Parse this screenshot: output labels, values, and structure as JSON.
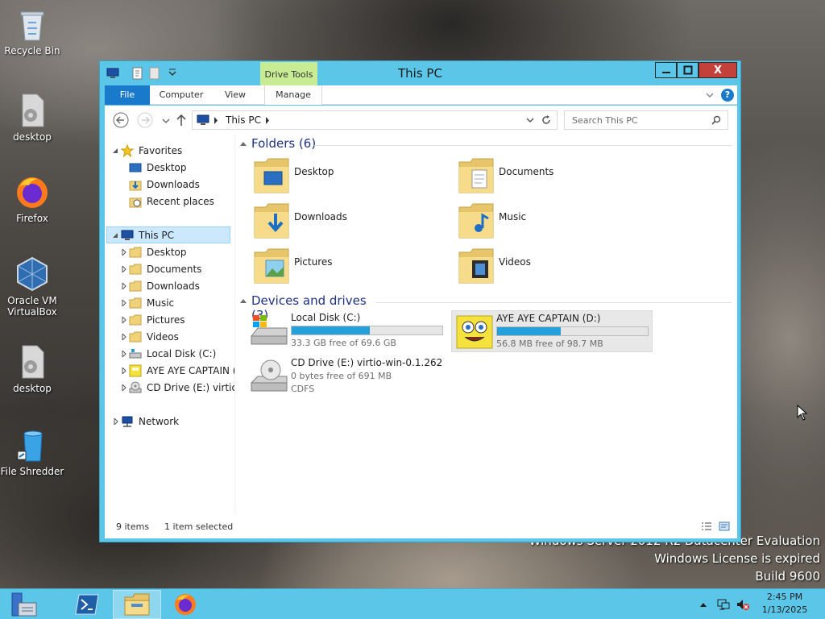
{
  "desktop": {
    "icons": [
      {
        "label": "Recycle Bin",
        "icon": "recycle-bin-icon"
      },
      {
        "label": "desktop",
        "icon": "gear-file-icon"
      },
      {
        "label": "Firefox",
        "icon": "firefox-icon"
      },
      {
        "label": "Oracle VM VirtualBox",
        "icon": "virtualbox-icon"
      },
      {
        "label": "desktop",
        "icon": "gear-file-icon"
      },
      {
        "label": "File Shredder",
        "icon": "file-shredder-icon"
      }
    ],
    "watermark": {
      "line1": "Windows Server 2012 R2 Datacenter Evaluation",
      "line2": "Windows License is expired",
      "line3": "Build 9600"
    }
  },
  "window": {
    "title": "This PC",
    "context_tab": "Drive Tools",
    "ribbon_tabs": {
      "file": "File",
      "computer": "Computer",
      "view": "View",
      "manage": "Manage"
    },
    "close_glyph": "X",
    "help_glyph": "?",
    "address": {
      "path": "This PC"
    },
    "search": {
      "placeholder": "Search This PC"
    },
    "nav": {
      "favorites": "Favorites",
      "fav_items": [
        "Desktop",
        "Downloads",
        "Recent places"
      ],
      "this_pc": "This PC",
      "pc_items": [
        "Desktop",
        "Documents",
        "Downloads",
        "Music",
        "Pictures",
        "Videos",
        "Local Disk (C:)",
        "AYE AYE CAPTAIN (",
        "CD Drive (E:) virtio-w"
      ],
      "network": "Network"
    },
    "folders_group": "Folders (6)",
    "folders": [
      {
        "name": "Desktop",
        "icon": "desktop-folder-icon"
      },
      {
        "name": "Documents",
        "icon": "documents-folder-icon"
      },
      {
        "name": "Downloads",
        "icon": "downloads-folder-icon"
      },
      {
        "name": "Music",
        "icon": "music-folder-icon"
      },
      {
        "name": "Pictures",
        "icon": "pictures-folder-icon"
      },
      {
        "name": "Videos",
        "icon": "videos-folder-icon"
      }
    ],
    "drives_group": "Devices and drives (3)",
    "drives": [
      {
        "name": "Local Disk (C:)",
        "free": "33.3 GB free of 69.6 GB",
        "used_fraction": 0.52,
        "icon": "hard-drive-icon"
      },
      {
        "name": "AYE AYE CAPTAIN (D:)",
        "free": "56.8 MB free of 98.7 MB",
        "used_fraction": 0.42,
        "icon": "spongebob-drive-icon"
      },
      {
        "name": "CD Drive (E:) virtio-win-0.1.262",
        "free": "0 bytes free of 691 MB",
        "fs": "CDFS",
        "icon": "cd-drive-icon"
      }
    ],
    "status": {
      "count": "9 items",
      "selection": "1 item selected"
    }
  },
  "taskbar": {
    "items": [
      "server-manager-icon",
      "powershell-icon",
      "file-explorer-icon",
      "firefox-icon"
    ],
    "clock": {
      "time": "2:45 PM",
      "date": "1/13/2025"
    }
  },
  "colors": {
    "accent": "#1979ca",
    "titlebar": "#5bc6e8",
    "close": "#c4403a",
    "drive_bar": "#26a0da",
    "context_tab": "#c7ec93"
  }
}
